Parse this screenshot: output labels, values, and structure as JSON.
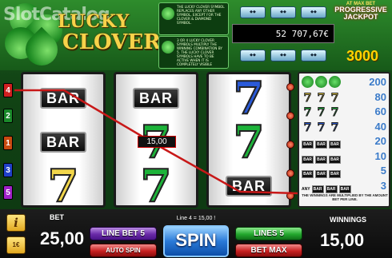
{
  "header": {
    "watermark": "SlotCatalog",
    "title_top": "LUCKY",
    "title_bottom": "CLOVER",
    "info_wild": "THE LUCKY CLOVER SYMBOL REPLACES ANY OTHER SYMBOL, EXCEPT FOR THE CLOVER & DIAMOND SYMBOL.",
    "info_bonus": "3 OR 4 LUCKY CLOVER SYMBOLS MULTIPLY THE WINNING COMBINATION BY 5. THE LUCKY CLOVER SYMBOLS HAVE TO BE ACTIVE WHEN IT IS COMPLETELY VISIBLE",
    "jackpot_value": "52 707,67€",
    "at_max_bet": "AT MAX BET",
    "progressive_label": "PROGRESSIVE JACKPOT",
    "coins": "3000"
  },
  "reels": [
    {
      "symbols": [
        {
          "kind": "bar",
          "label": "BAR"
        },
        {
          "kind": "bar",
          "label": "BAR"
        },
        {
          "kind": "seven",
          "color": "gold"
        }
      ]
    },
    {
      "symbols": [
        {
          "kind": "bar",
          "label": "BAR"
        },
        {
          "kind": "seven",
          "color": "green"
        },
        {
          "kind": "seven",
          "color": "green"
        }
      ]
    },
    {
      "symbols": [
        {
          "kind": "seven",
          "color": "blue"
        },
        {
          "kind": "seven",
          "color": "green"
        },
        {
          "kind": "bar",
          "label": "BAR"
        }
      ]
    }
  ],
  "line_numbers": [
    {
      "label": "4",
      "color": "#d02020"
    },
    {
      "label": "2",
      "color": "#1a8a2a"
    },
    {
      "label": "1",
      "color": "#c84a10"
    },
    {
      "label": "3",
      "color": "#2040c8"
    },
    {
      "label": "5",
      "color": "#a020c8"
    }
  ],
  "win_label": "15,00",
  "paytable": {
    "rows": [
      {
        "icon": "clover",
        "value": "200"
      },
      {
        "icon": "seven-gold",
        "value": "80"
      },
      {
        "icon": "seven-green",
        "value": "60"
      },
      {
        "icon": "seven-blue",
        "value": "40"
      },
      {
        "icon": "bar3",
        "value": "20"
      },
      {
        "icon": "bar2",
        "value": "10"
      },
      {
        "icon": "bar1",
        "value": "5"
      },
      {
        "icon": "any-bar",
        "value": "3",
        "prefix": "ANY"
      }
    ],
    "note": "THE WINNINGS ARE MULTIPLIED BY THE AMOUNT BET PER LINE."
  },
  "bottom": {
    "info_button": "i",
    "coin_button": "1€",
    "bet_label": "BET",
    "bet_value": "25,00",
    "line_bet_button": "LINE BET 5",
    "auto_spin_button": "AUTO SPIN",
    "status": "Line 4 = 15,00 !",
    "spin_button": "SPIN",
    "lines_button": "LINES 5",
    "bet_max_button": "BET MAX",
    "winnings_label": "WINNINGS",
    "winnings_value": "15,00"
  },
  "colors": {
    "accent_gold": "#f7d24a",
    "payline_red": "#c81818",
    "spin_blue": "#2a7ad8"
  }
}
